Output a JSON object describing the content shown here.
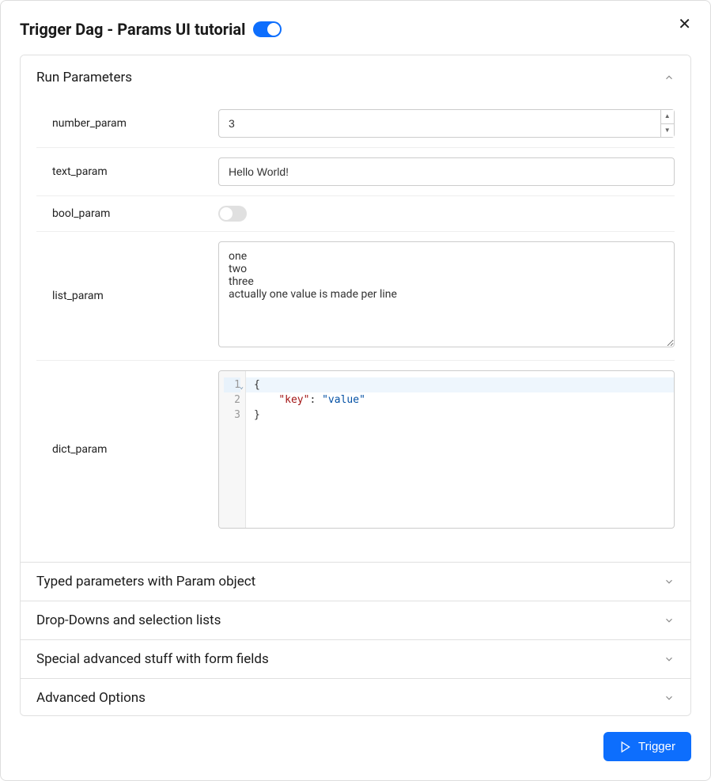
{
  "header": {
    "title": "Trigger Dag - Params UI tutorial",
    "toggle_on": true
  },
  "sections": {
    "run_params": {
      "title": "Run Parameters",
      "fields": {
        "number_param": {
          "label": "number_param",
          "value": "3"
        },
        "text_param": {
          "label": "text_param",
          "value": "Hello World!"
        },
        "bool_param": {
          "label": "bool_param",
          "value": false
        },
        "list_param": {
          "label": "list_param",
          "value": "one\ntwo\nthree\nactually one value is made per line"
        },
        "dict_param": {
          "label": "dict_param",
          "lines": [
            "{",
            "    \"key\": \"value\"",
            "}"
          ],
          "line_numbers": [
            "1",
            "2",
            "3"
          ]
        }
      }
    },
    "typed": {
      "title": "Typed parameters with Param object"
    },
    "dropdowns": {
      "title": "Drop-Downs and selection lists"
    },
    "special": {
      "title": "Special advanced stuff with form fields"
    },
    "advanced": {
      "title": "Advanced Options"
    }
  },
  "footer": {
    "trigger_label": "Trigger"
  }
}
